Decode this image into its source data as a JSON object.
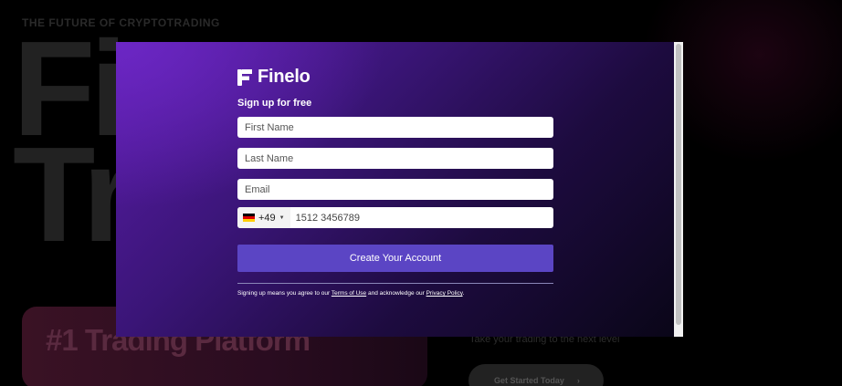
{
  "background": {
    "tagline": "THE FUTURE OF CRYPTOTRADING",
    "hero_line1": "Fi",
    "hero_line2": "Tr",
    "badge_text": "#1 Trading Platform",
    "subtext": "Take your trading to the next level",
    "cta_label": "Get Started Today",
    "cta_icon": "chevron-right-icon"
  },
  "modal": {
    "brand_name": "Finelo",
    "brand_logo_icon": "finelo-f-logo",
    "form_title": "Sign up for free",
    "fields": {
      "first_name": {
        "placeholder": "First Name",
        "value": ""
      },
      "last_name": {
        "placeholder": "Last Name",
        "value": ""
      },
      "email": {
        "placeholder": "Email",
        "value": ""
      },
      "phone": {
        "country_flag": "germany-flag",
        "country_code": "+49",
        "value": "1512 3456789"
      }
    },
    "submit_label": "Create Your Account",
    "legal": {
      "prefix": "Signing up means you agree to our ",
      "terms_link": "Terms of Use",
      "middle": " and acknowledge our ",
      "privacy_link": "Privacy Policy",
      "suffix": "."
    },
    "colors": {
      "accent": "#5b45c4",
      "gradient_start": "#5a1ca8",
      "gradient_end": "#0a0618"
    }
  }
}
